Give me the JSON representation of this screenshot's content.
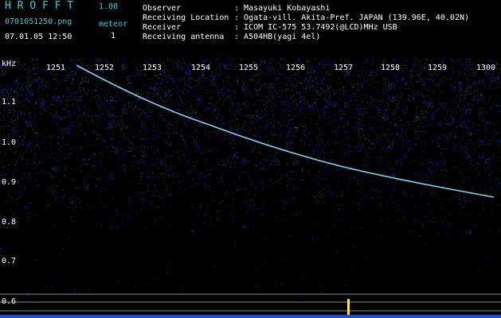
{
  "app": {
    "title": "H R O F F T",
    "version": "1.00"
  },
  "file": {
    "name": "0701051250.png",
    "datetime": "07.01.05 12:50"
  },
  "counter": {
    "label": "meteor",
    "value": "1"
  },
  "info": [
    {
      "label": "Observer",
      "value": ": Masayuki Kobayashi"
    },
    {
      "label": "Receiving Location",
      "value": ": Ogata-vill. Akita-Pref. JAPAN (139.96E, 40.02N)"
    },
    {
      "label": "Receiver",
      "value": ": ICOM IC-575 53.7492(@LCD)MHz USB"
    },
    {
      "label": "Receiving antenna",
      "value": ": A504HB(yagi 4el)"
    }
  ],
  "axes": {
    "y_unit": "kHz",
    "y_ticks": [
      "1.1",
      "1.0",
      "0.9",
      "0.8",
      "0.7",
      "0.6"
    ],
    "x_ticks": [
      "1251",
      "1252",
      "1253",
      "1254",
      "1255",
      "1256",
      "1257",
      "1258",
      "1259",
      "1300"
    ]
  },
  "colors": {
    "header_text": "#2fd3e6",
    "background": "#000000",
    "trail": "#7fd6ff",
    "noise": "#2440d8"
  }
}
